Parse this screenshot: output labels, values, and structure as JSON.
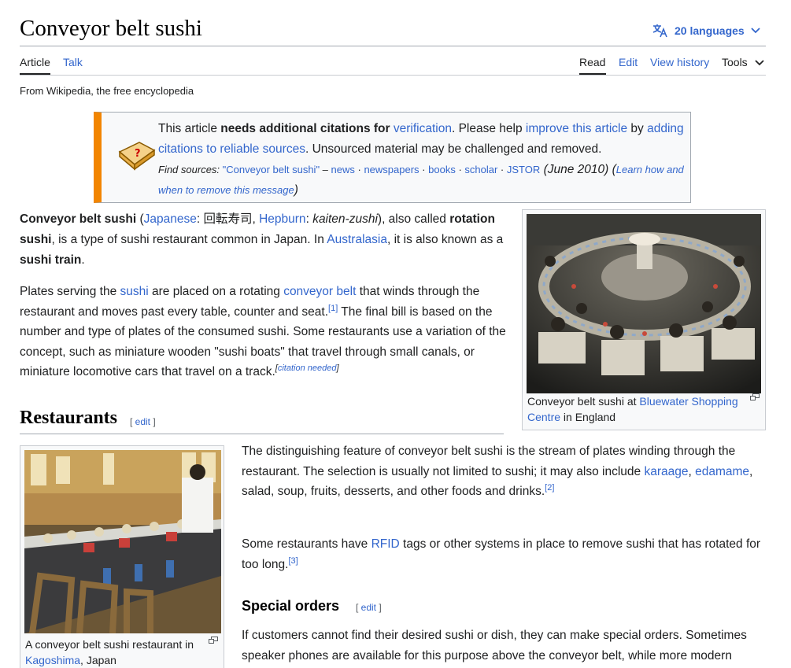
{
  "page": {
    "title": "Conveyor belt sushi",
    "languages_label": "20 languages",
    "tagline": "From Wikipedia, the free encyclopedia"
  },
  "icons": {
    "language": "translate-icon",
    "chevron": "chevron-down-icon",
    "ambox": "book-question-icon",
    "magnify": "magnify-clip-icon"
  },
  "colors": {
    "link": "#3366cc",
    "ambox_stripe": "#f28500",
    "text": "#202122"
  },
  "tabs": {
    "article": "Article",
    "talk": "Talk",
    "read": "Read",
    "edit": "Edit",
    "history": "View history",
    "tools": "Tools"
  },
  "ambox": {
    "t1": "This article ",
    "t2": "needs additional citations for ",
    "t3": "verification",
    "t4": ". Please help ",
    "t5": "improve this article",
    "t6": " by ",
    "t7": "adding citations to reliable sources",
    "t8": ". Unsourced material may be challenged and removed.",
    "find_label": "Find sources: ",
    "find_query": "\"Conveyor belt sushi\"",
    "dash": " – ",
    "news": "news",
    "sep": " · ",
    "newspapers": "newspapers",
    "books": "books",
    "scholar": "scholar",
    "jstor": "JSTOR",
    "date": " (June 2010) (",
    "learn": "Learn how and when to remove this message",
    "close": ")"
  },
  "lead": {
    "b1": "Conveyor belt sushi",
    "t1": " (",
    "japanese": "Japanese",
    "t2": ": 回転寿司, ",
    "hepburn": "Hepburn",
    "t3": ": ",
    "romaji": "kaiten-zushi",
    "t4": "), also called ",
    "b2": "rotation sushi",
    "t5": ", is a type of sushi restaurant common in Japan. In ",
    "australasia": "Australasia",
    "t6": ", it is also known as a ",
    "b3": "sushi train",
    "t7": "."
  },
  "para2": {
    "t1": "Plates serving the ",
    "sushi": "sushi",
    "t2": " are placed on a rotating ",
    "conveyor": "conveyor belt",
    "t3": " that winds through the restaurant and moves past every table, counter and seat.",
    "ref1": "[1]",
    "t4": " The final bill is based on the number and type of plates of the consumed sushi. Some restaurants use a variation of the concept, such as miniature wooden \"sushi boats\" that travel through small canals, or miniature locomotive cars that travel on a track.",
    "cn_open": "[",
    "cn": "citation needed",
    "cn_close": "]"
  },
  "thumb1": {
    "cap1": "Conveyor belt sushi at ",
    "link": "Bluewater Shopping Centre",
    "cap2": " in England"
  },
  "restaurants": {
    "heading": "Restaurants",
    "edit_open": "[ ",
    "edit": "edit",
    "edit_close": " ]",
    "p1_t1": "The distinguishing feature of conveyor belt sushi is the stream of plates winding through the restaurant. The selection is usually not limited to sushi; it may also include ",
    "karaage": "karaage",
    "comma": ", ",
    "edamame": "edamame",
    "p1_t2": ", salad, soup, fruits, desserts, and other foods and drinks.",
    "ref2": "[2]",
    "p2_t1": "Some restaurants have ",
    "rfid": "RFID",
    "p2_t2": " tags or other systems in place to remove sushi that has rotated for too long.",
    "ref3": "[3]"
  },
  "thumb2": {
    "cap1": "A conveyor belt sushi restaurant in ",
    "link": "Kagoshima",
    "cap2": ", Japan"
  },
  "special": {
    "heading": "Special orders",
    "p_t1": "If customers cannot find their desired sushi or dish, they can make special orders. Sometimes speaker phones are available for this purpose above the conveyor belt, while more modern"
  }
}
